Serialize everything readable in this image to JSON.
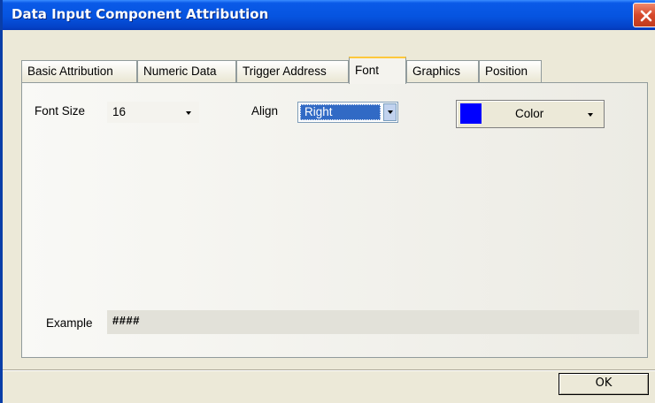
{
  "window": {
    "title": "Data Input Component Attribution"
  },
  "tabs": [
    {
      "label": "Basic Attribution",
      "active": false
    },
    {
      "label": "Numeric Data",
      "active": false
    },
    {
      "label": "Trigger Address",
      "active": false
    },
    {
      "label": "Font",
      "active": true
    },
    {
      "label": "Graphics",
      "active": false
    },
    {
      "label": "Position",
      "active": false
    }
  ],
  "font": {
    "size_label": "Font Size",
    "size_value": "16",
    "align_label": "Align",
    "align_value": "Right",
    "color_label": "Color",
    "color_value": "#0000ff"
  },
  "example": {
    "label": "Example",
    "value": "####"
  },
  "buttons": {
    "ok": "OK"
  },
  "icons": {
    "close": "close-icon",
    "dropdown": "chevron-down-icon"
  }
}
